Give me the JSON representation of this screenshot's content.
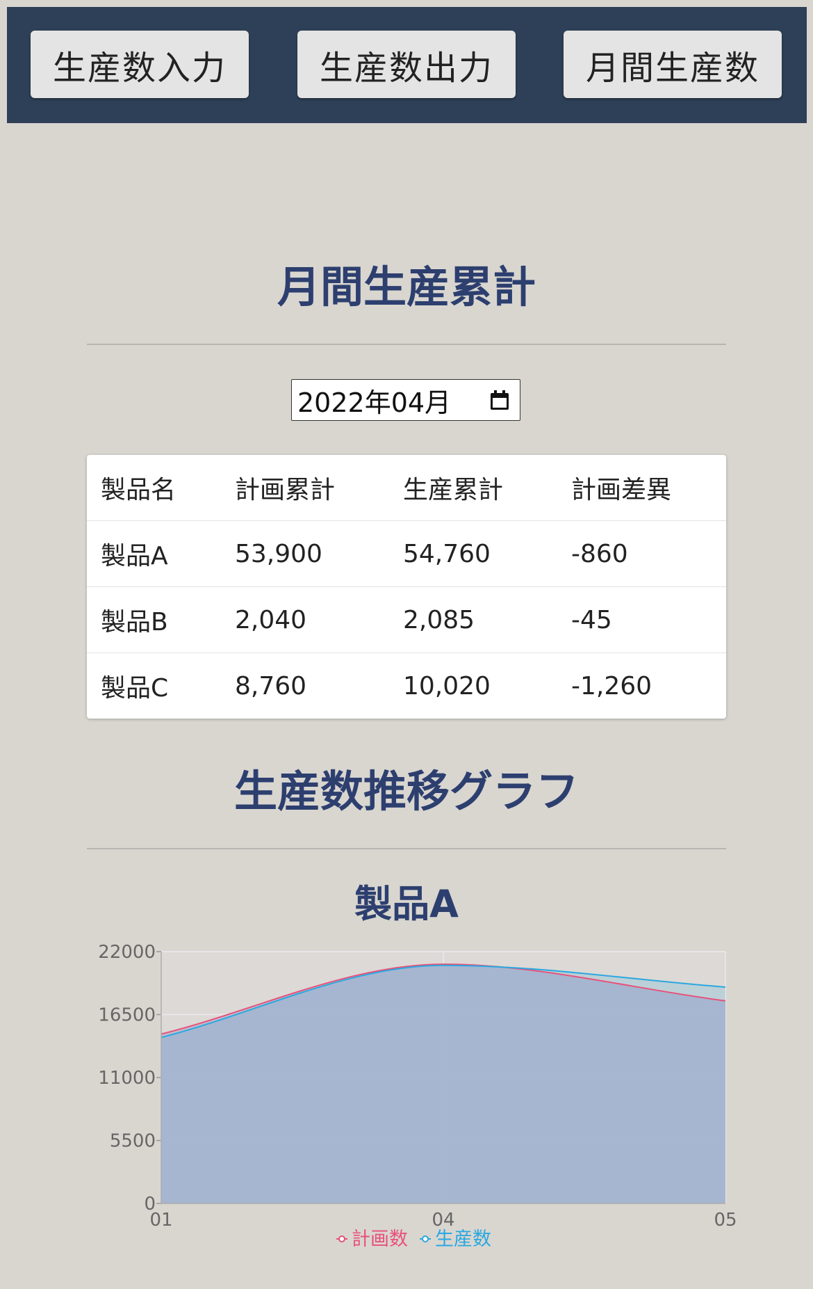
{
  "nav": {
    "buttons": [
      "生産数入力",
      "生産数出力",
      "月間生産数"
    ]
  },
  "summary": {
    "title": "月間生産累計",
    "month_value": "2022年04月",
    "table": {
      "headers": [
        "製品名",
        "計画累計",
        "生産累計",
        "計画差異"
      ],
      "rows": [
        [
          "製品A",
          "53,900",
          "54,760",
          "-860"
        ],
        [
          "製品B",
          "2,040",
          "2,085",
          "-45"
        ],
        [
          "製品C",
          "8,760",
          "10,020",
          "-1,260"
        ]
      ]
    }
  },
  "graph_section": {
    "title": "生産数推移グラフ"
  },
  "chart_data": {
    "type": "area",
    "title": "製品A",
    "x": [
      "01",
      "04",
      "05"
    ],
    "series": [
      {
        "name": "計画数",
        "values": [
          14800,
          20900,
          17700
        ],
        "color": "#e8517a"
      },
      {
        "name": "生産数",
        "values": [
          14500,
          20800,
          18900
        ],
        "color": "#2aa8e0"
      }
    ],
    "ylim": [
      0,
      22000
    ],
    "yticks": [
      "0",
      "5500",
      "11000",
      "16500",
      "22000"
    ],
    "grid": true,
    "legend": "bottom",
    "fill_color": "#bfb8cc"
  }
}
